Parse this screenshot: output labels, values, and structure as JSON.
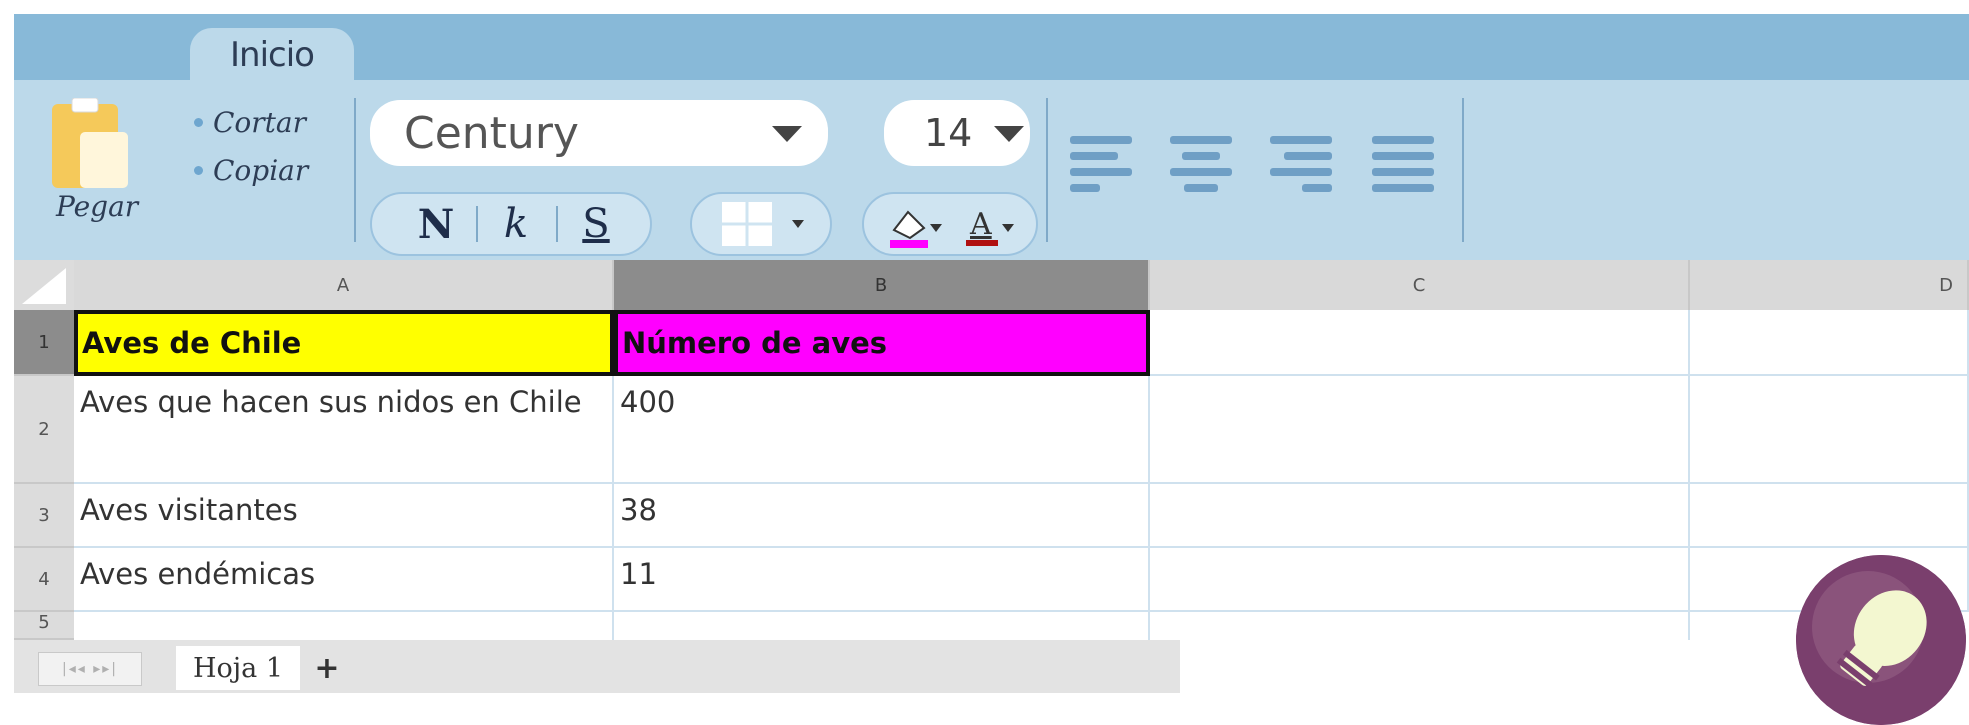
{
  "ribbon": {
    "tab_label": "Inicio",
    "paste_label": "Pegar",
    "cut_label": "Cortar",
    "copy_label": "Copiar",
    "font_family": "Century",
    "font_size": "14",
    "bold_label": "N",
    "italic_label": "k",
    "underline_label": "S"
  },
  "grid": {
    "columns": [
      "A",
      "B",
      "C",
      "D"
    ],
    "rows": [
      "1",
      "2",
      "3",
      "4",
      "5"
    ],
    "header_row": {
      "a": "Aves de Chile",
      "b": "Número de aves"
    },
    "data_rows": [
      {
        "a": "Aves que hacen sus nidos en Chile",
        "b": "400"
      },
      {
        "a": "Aves visitantes",
        "b": "38"
      },
      {
        "a": "Aves endémicas",
        "b": "11"
      }
    ]
  },
  "sheets": {
    "nav": "|◂◂ ▸▸|",
    "active_tab": "Hoja 1",
    "add_label": "+"
  },
  "colors": {
    "ribbon_bg": "#bcd9ea",
    "tabstrip_bg": "#88b9d8",
    "header_yellow": "#ffff00",
    "header_magenta": "#ff00ff"
  }
}
